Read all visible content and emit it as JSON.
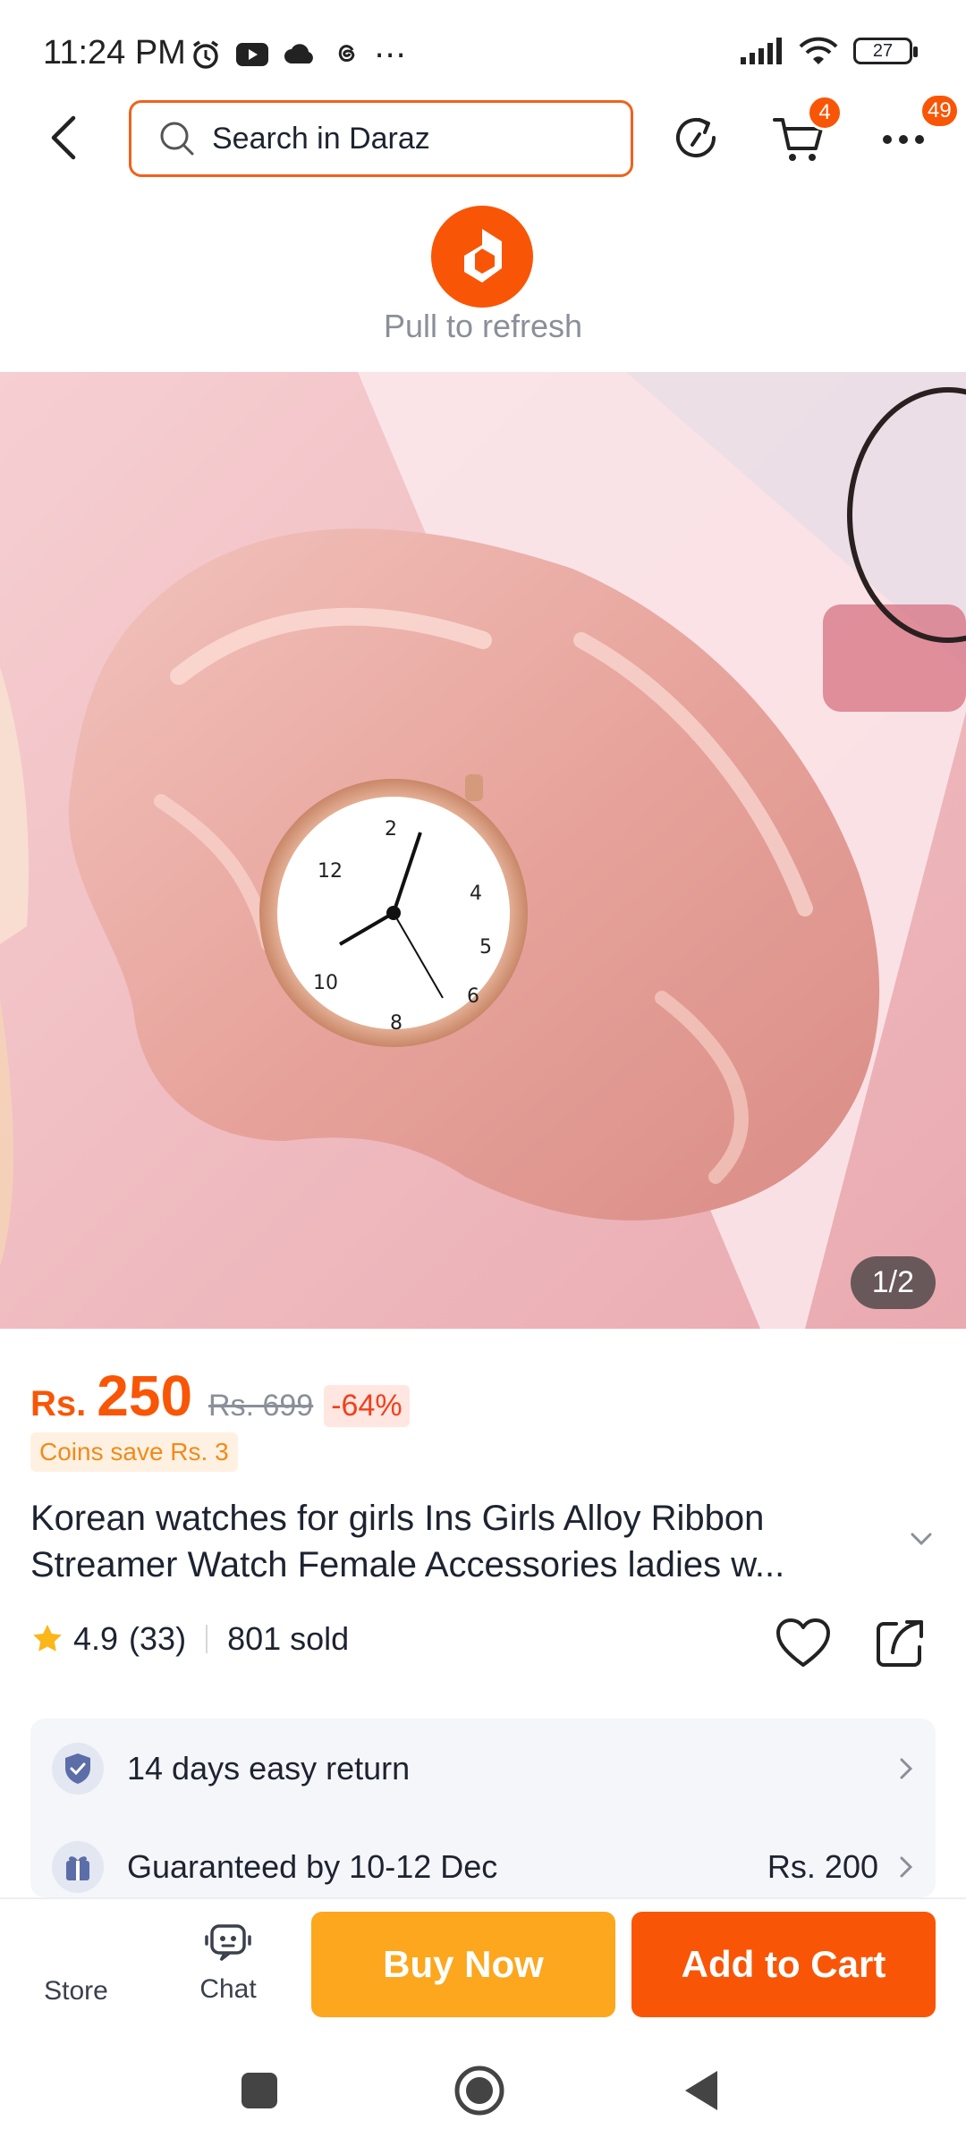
{
  "status_bar": {
    "time": "11:24 PM",
    "more": "⋯",
    "battery": "27"
  },
  "header": {
    "search_placeholder": "Search in Daraz",
    "cart_badge": "4",
    "more_badge": "49"
  },
  "refresh": {
    "text": "Pull to refresh"
  },
  "gallery": {
    "counter": "1/2"
  },
  "price": {
    "currency": "Rs.",
    "current": "250",
    "original": "Rs. 699",
    "discount": "-64%",
    "coins": "Coins save Rs. 3"
  },
  "product": {
    "title": "Korean watches for girls Ins Girls Alloy Ribbon Streamer Watch Female Accessories ladies w...",
    "rating": "4.9",
    "reviews": "(33)",
    "sold": "801 sold"
  },
  "services": [
    {
      "label": "14 days easy return",
      "value": ""
    },
    {
      "label": "Guaranteed by 10-12 Dec",
      "value": "Rs. 200"
    }
  ],
  "action_bar": {
    "store": "Store",
    "chat": "Chat",
    "buy_now": "Buy Now",
    "add_to_cart": "Add to Cart"
  },
  "colors": {
    "brand": "#f85606",
    "buy_now": "#fca71d"
  }
}
